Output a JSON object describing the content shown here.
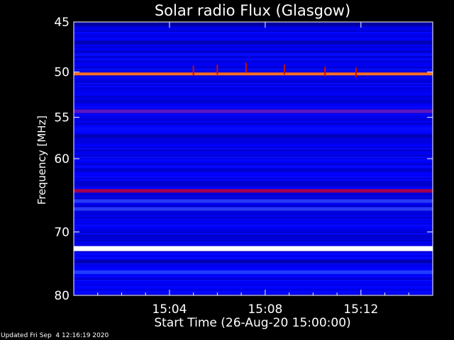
{
  "chart_data": {
    "type": "heatmap",
    "title": "Solar radio Flux (Glasgow)",
    "xlabel": "Start Time (26-Aug-20 15:00:00)",
    "ylabel": "Frequency [MHz]",
    "x_unit": "minutes after 15:00:00",
    "xlim": [
      0,
      15
    ],
    "ylim": [
      45,
      80
    ],
    "y_reversed": true,
    "y_scale": "log",
    "x_ticks": [
      {
        "value": 4,
        "label": "15:04"
      },
      {
        "value": 8,
        "label": "15:08"
      },
      {
        "value": 12,
        "label": "15:12"
      }
    ],
    "y_ticks": [
      {
        "value": 45,
        "label": "45"
      },
      {
        "value": 50,
        "label": "50"
      },
      {
        "value": 55,
        "label": "55"
      },
      {
        "value": 60,
        "label": "60"
      },
      {
        "value": 70,
        "label": "70"
      },
      {
        "value": 80,
        "label": "80"
      }
    ],
    "colormap": [
      "#000090",
      "#0000ff",
      "#2040ff",
      "#8000a0",
      "#c00000",
      "#ff4000",
      "#ffff80",
      "#ffffff"
    ],
    "background_level": 0.12,
    "bands": [
      {
        "freq": 45.2,
        "intensity": 0.02
      },
      {
        "freq": 47.0,
        "intensity": 0.05
      },
      {
        "freq": 50.2,
        "intensity": 0.75
      },
      {
        "freq": 54.3,
        "intensity": 0.38
      },
      {
        "freq": 57.2,
        "intensity": 0.05
      },
      {
        "freq": 64.2,
        "intensity": 0.5
      },
      {
        "freq": 65.6,
        "intensity": 0.3
      },
      {
        "freq": 66.7,
        "intensity": 0.3
      },
      {
        "freq": 72.5,
        "intensity": 1.0
      },
      {
        "freq": 74.5,
        "intensity": 0.04
      },
      {
        "freq": 76.2,
        "intensity": 0.28
      }
    ],
    "bursts": [
      {
        "x": 5.0,
        "freq": 50.0
      },
      {
        "x": 6.0,
        "freq": 49.9
      },
      {
        "x": 7.2,
        "freq": 49.7
      },
      {
        "x": 8.8,
        "freq": 49.9
      },
      {
        "x": 10.5,
        "freq": 50.1
      },
      {
        "x": 11.8,
        "freq": 50.2
      }
    ]
  },
  "footer": {
    "updated": "Updated Fri Sep  4 12:16:19 2020"
  }
}
